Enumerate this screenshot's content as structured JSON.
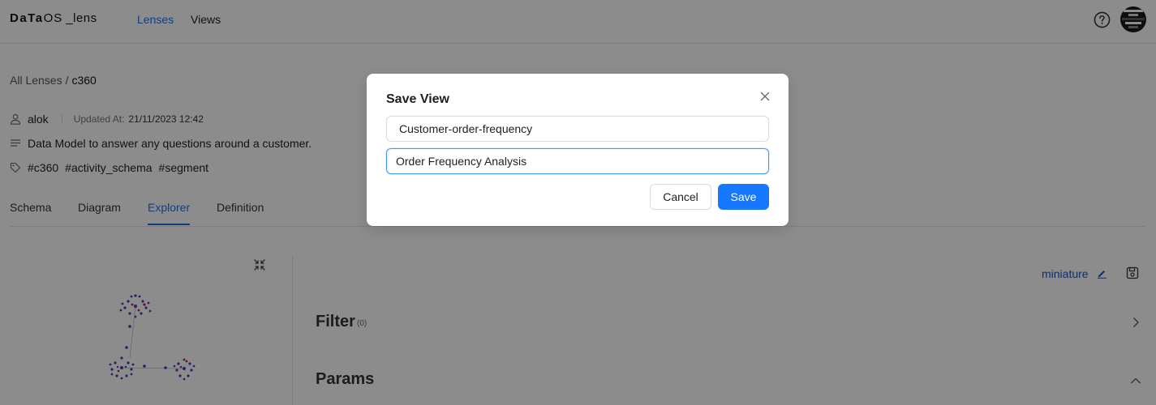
{
  "header": {
    "logo_brand": "DaTa",
    "logo_os": "OS",
    "logo_suffix": "_lens",
    "nav": [
      "Lenses",
      "Views"
    ],
    "help_icon": "question-circle-icon",
    "avatar_icon": "avatar"
  },
  "breadcrumb": {
    "root": "All Lenses",
    "separator": "/",
    "current": "c360"
  },
  "lens": {
    "owner": "alok",
    "updated_label": "Updated At:",
    "updated_value": "21/11/2023 12:42",
    "description": "Data Model to answer any questions around a customer.",
    "tags": [
      "#c360",
      "#activity_schema",
      "#segment"
    ]
  },
  "tabs": [
    "Schema",
    "Diagram",
    "Explorer",
    "Definition"
  ],
  "active_tab": "Explorer",
  "explorer": {
    "view_name": "miniature",
    "sections": [
      {
        "title": "Filter",
        "count": "(0)"
      },
      {
        "title": "Params"
      }
    ]
  },
  "modal": {
    "title": "Save View",
    "name_value": "Customer-order-frequency",
    "description_value": "Order Frequency Analysis",
    "cancel_label": "Cancel",
    "save_label": "Save"
  },
  "colors": {
    "accent": "#1677ff",
    "link": "#1a73e8",
    "overlay": "rgba(0,0,0,0.45)"
  }
}
